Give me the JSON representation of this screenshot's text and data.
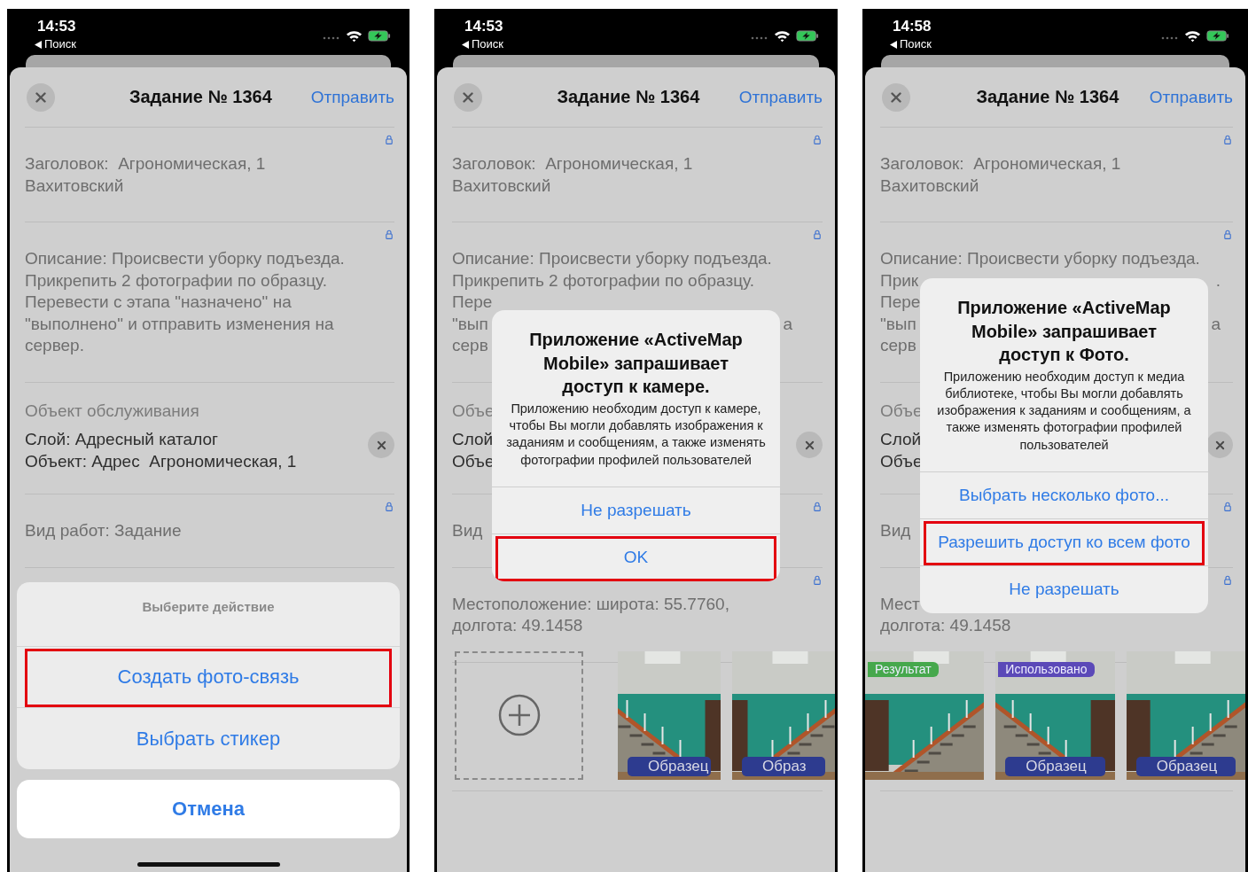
{
  "phones": [
    {
      "status": {
        "time": "14:53",
        "back": "Поиск"
      },
      "header": {
        "title": "Задание № 1364",
        "action": "Отправить"
      },
      "home_indicator": true,
      "sections": [
        {
          "kind": "field",
          "locked": true,
          "lines": [
            {
              "text": "Заголовок:  Агрономическая, 1"
            },
            {
              "text": "Вахитовский"
            }
          ]
        },
        {
          "kind": "field",
          "locked": true,
          "lines": [
            {
              "text": "Описание: Происвести уборку подъезда."
            },
            {
              "text": "Прикрепить 2 фотографии по образцу."
            },
            {
              "text": "Перевести с этапа \"назначено\" на"
            },
            {
              "text": "\"выполнено\" и отправить изменения на"
            },
            {
              "text": "сервер."
            }
          ]
        },
        {
          "kind": "object",
          "label": "Объект обслуживания",
          "clearable": true,
          "lines": [
            {
              "text": "Слой: Адресный каталог"
            },
            {
              "text": "Объект: Адрес  Агрономическая, 1"
            }
          ]
        },
        {
          "kind": "field",
          "locked": true,
          "lines": [
            {
              "text": "Вид работ: Задание"
            }
          ]
        }
      ],
      "overlay": {
        "kind": "action_sheet",
        "title": "Выберите действие",
        "actions": [
          {
            "label": "Создать фото-связь",
            "highlighted": true
          },
          {
            "label": "Выбрать стикер",
            "highlighted": false
          }
        ],
        "cancel": "Отмена"
      }
    },
    {
      "status": {
        "time": "14:53",
        "back": "Поиск"
      },
      "header": {
        "title": "Задание № 1364",
        "action": "Отправить"
      },
      "sections": [
        {
          "kind": "field",
          "locked": true,
          "lines": [
            {
              "text": "Заголовок:  Агрономическая, 1"
            },
            {
              "text": "Вахитовский"
            }
          ]
        },
        {
          "kind": "field",
          "locked": true,
          "lines": [
            {
              "text": "Описание: Происвести уборку подъезда."
            },
            {
              "text": "Прикрепить 2 фотографии по образцу."
            },
            {
              "text": "Пере"
            },
            {
              "text": "\"вып",
              "right": "а"
            },
            {
              "text": "серв"
            }
          ]
        },
        {
          "kind": "object",
          "label": "Объе",
          "clearable": true,
          "lines": [
            {
              "text": "Слой"
            },
            {
              "text": "Объе"
            }
          ]
        },
        {
          "kind": "field",
          "locked": true,
          "lines": [
            {
              "text": "Вид"
            }
          ]
        },
        {
          "kind": "field",
          "locked": true,
          "lines": [
            {
              "text": "Местоположение: широта: 55.7760,"
            },
            {
              "text": "долгота: 49.1458"
            }
          ]
        },
        {
          "kind": "photos",
          "items": [
            {
              "kind": "add"
            },
            {
              "badges": [
                {
                  "text": "Образец",
                  "kind": "caption",
                  "color": "#2d3b8f"
                }
              ]
            },
            {
              "badges": [
                {
                  "text": "Образ",
                  "kind": "caption",
                  "color": "#2d3b8f"
                }
              ]
            }
          ]
        }
      ],
      "overlay": {
        "kind": "alert",
        "title": "Приложение «ActiveMap Mobile» запрашивает доступ к камере.",
        "message": "Приложению необходим доступ к камере, чтобы Вы могли добавлять изображения к заданиям и сообщениям, а также изменять фотографии профилей пользователей",
        "actions": [
          {
            "label": "Не разрешать",
            "highlighted": false
          },
          {
            "label": "OK",
            "highlighted": true
          }
        ]
      }
    },
    {
      "status": {
        "time": "14:58",
        "back": "Поиск"
      },
      "header": {
        "title": "Задание № 1364",
        "action": "Отправить"
      },
      "sections": [
        {
          "kind": "field",
          "locked": true,
          "lines": [
            {
              "text": "Заголовок:  Агрономическая, 1"
            },
            {
              "text": "Вахитовский"
            }
          ]
        },
        {
          "kind": "field",
          "locked": true,
          "lines": [
            {
              "text": "Описание: Происвести уборку подъезда."
            },
            {
              "text": "Прик",
              "right": "."
            },
            {
              "text": "Пере"
            },
            {
              "text": "\"вып",
              "right": "а"
            },
            {
              "text": "серв"
            }
          ]
        },
        {
          "kind": "object",
          "label": "Объе",
          "clearable": true,
          "lines": [
            {
              "text": "Слой"
            },
            {
              "text": "Объе"
            }
          ]
        },
        {
          "kind": "field",
          "locked": true,
          "lines": [
            {
              "text": "Вид"
            }
          ]
        },
        {
          "kind": "field",
          "locked": true,
          "lines": [
            {
              "text": "Мест"
            },
            {
              "text": "долгота: 49.1458"
            }
          ]
        },
        {
          "kind": "photos",
          "items": [
            {
              "badges": [
                {
                  "text": "Результат",
                  "kind": "tag",
                  "color": "#46a84c"
                }
              ]
            },
            {
              "badges": [
                {
                  "text": "Использовано",
                  "kind": "tag",
                  "color": "#5b49b8"
                },
                {
                  "text": "Образец",
                  "kind": "caption",
                  "color": "#2d3b8f"
                }
              ]
            },
            {
              "badges": [
                {
                  "text": "Образец",
                  "kind": "caption",
                  "color": "#2d3b8f"
                }
              ]
            }
          ]
        }
      ],
      "overlay": {
        "kind": "alert",
        "title": "Приложение «ActiveMap Mobile» запрашивает доступ к Фото.",
        "message": "Приложению необходим доступ к медиа библиотеке, чтобы Вы могли добавлять изображения к заданиям и сообщениям, а также изменять фотографии профилей пользователей",
        "actions": [
          {
            "label": "Выбрать несколько фото...",
            "highlighted": false
          },
          {
            "label": "Разрешить доступ ко всем фото",
            "highlighted": true
          },
          {
            "label": "Не разрешать",
            "highlighted": false
          }
        ]
      }
    }
  ]
}
